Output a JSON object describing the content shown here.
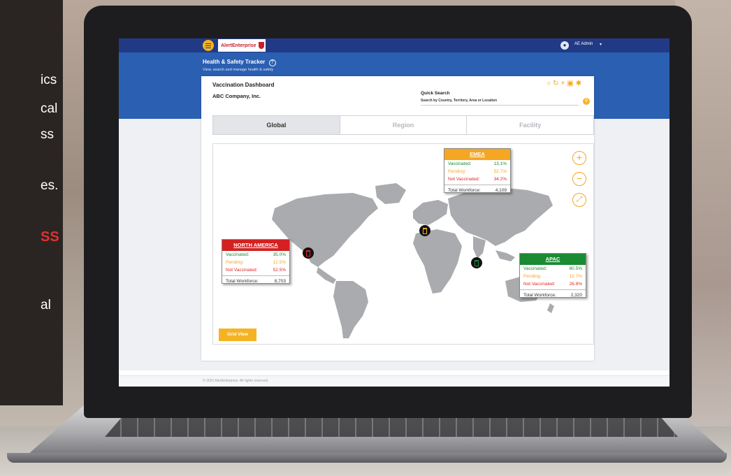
{
  "background": {
    "left_text": [
      "ics",
      "cal",
      "ss",
      "es.",
      "SS",
      "al"
    ]
  },
  "app": {
    "logo": "AlertEnterprise",
    "user": {
      "name": "AE Admin",
      "caret": "▾"
    },
    "header": {
      "title": "Health & Safety Tracker",
      "help": "?",
      "description": "View, search and manage health & safety"
    },
    "dashboard": {
      "title": "Vaccination Dashboard",
      "company": "ABC Company, Inc.",
      "quick_search": {
        "label": "Quick Search",
        "hint": "Search by Country, Territory, Area or Location"
      },
      "toolbar_icons": [
        "refresh-icon",
        "sync-icon",
        "add-icon",
        "save-icon",
        "settings-icon"
      ],
      "tabs": [
        {
          "label": "Global",
          "active": true
        },
        {
          "label": "Region",
          "active": false
        },
        {
          "label": "Facility",
          "active": false
        }
      ],
      "map_controls": [
        "zoom-in-icon",
        "zoom-out-icon",
        "fit-screen-icon"
      ],
      "grid_view_label": "Grid View"
    },
    "regions": [
      {
        "name": "NORTH AMERICA",
        "color": "#d32121",
        "vaccinated_label": "Vaccinated:",
        "vaccinated": "35.0%",
        "pending_label": "Pending:",
        "pending": "12.5%",
        "not_vaccinated_label": "Not Vaccinated:",
        "not_vaccinated": "52.5%",
        "total_label": "Total Workforce:",
        "total": "8,703"
      },
      {
        "name": "EMEA",
        "color": "#f5a623",
        "vaccinated_label": "Vaccinated:",
        "vaccinated": "13.1%",
        "pending_label": "Pending:",
        "pending": "52.7%",
        "not_vaccinated_label": "Not Vaccinated:",
        "not_vaccinated": "34.2%",
        "total_label": "Total Workforce:",
        "total": "4,109"
      },
      {
        "name": "APAC",
        "color": "#1a8a33",
        "vaccinated_label": "Vaccinated:",
        "vaccinated": "60.5%",
        "pending_label": "Pending:",
        "pending": "12.7%",
        "not_vaccinated_label": "Not Vaccinated:",
        "not_vaccinated": "26.8%",
        "total_label": "Total Workforce:",
        "total": "2,320"
      }
    ],
    "footer": "© 2021 AlertEnterprise. All rights reserved."
  },
  "colors": {
    "topbar": "#223a85",
    "header": "#2b5fb2",
    "accent": "#f5b324",
    "green": "#1a8a33",
    "orange": "#f5a623",
    "red": "#e02727"
  }
}
